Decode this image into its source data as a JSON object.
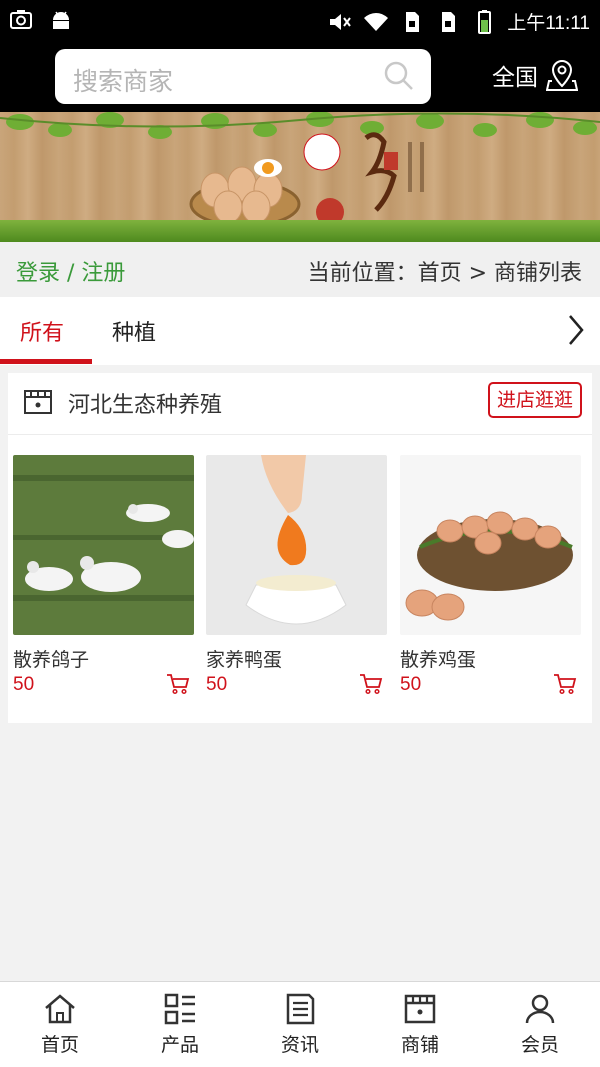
{
  "status_bar": {
    "time": "上午11:11"
  },
  "header": {
    "search_placeholder": "搜索商家",
    "region_label": "全国"
  },
  "breadcrumb": {
    "login_register": "登录 / 注册",
    "location": "当前位置：首页 > 商铺列表"
  },
  "tabs": [
    {
      "label": "所有",
      "active": true
    },
    {
      "label": "种植",
      "active": false
    }
  ],
  "shop": {
    "name": "河北生态种养殖",
    "visit_label": "进店逛逛",
    "products": [
      {
        "name": "散养鸽子",
        "price": "50",
        "image": "pigeons-photo"
      },
      {
        "name": "家养鸭蛋",
        "price": "50",
        "image": "duck-egg-yolk-photo"
      },
      {
        "name": "散养鸡蛋",
        "price": "50",
        "image": "eggs-in-nest-photo"
      }
    ]
  },
  "bottom_nav": [
    {
      "label": "首页",
      "icon": "home-icon"
    },
    {
      "label": "产品",
      "icon": "product-grid-icon"
    },
    {
      "label": "资讯",
      "icon": "news-icon"
    },
    {
      "label": "商铺",
      "icon": "shop-icon"
    },
    {
      "label": "会员",
      "icon": "member-icon"
    }
  ],
  "colors": {
    "accent": "#d0121b",
    "login_green": "#3a9a3a",
    "header_bg": "#000000"
  }
}
